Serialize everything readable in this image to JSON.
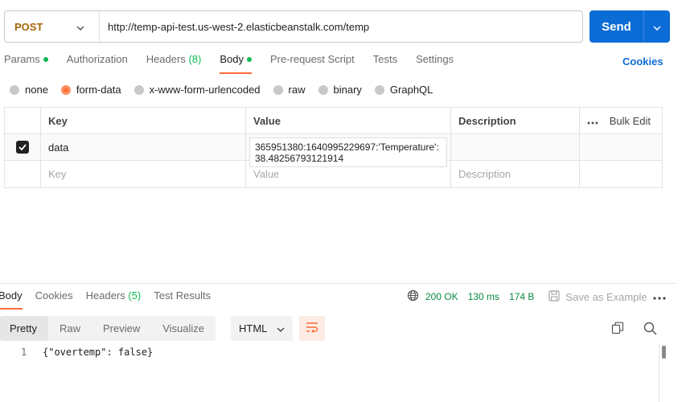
{
  "request": {
    "method": "POST",
    "url": "http://temp-api-test.us-west-2.elasticbeanstalk.com/temp",
    "send_label": "Send"
  },
  "request_tabs": [
    {
      "label": "Params",
      "dot": true
    },
    {
      "label": "Authorization"
    },
    {
      "label": "Headers",
      "count": "(8)"
    },
    {
      "label": "Body",
      "dot": true,
      "active": true
    },
    {
      "label": "Pre-request Script"
    },
    {
      "label": "Tests"
    },
    {
      "label": "Settings"
    }
  ],
  "cookies_label": "Cookies",
  "body_types": [
    {
      "label": "none"
    },
    {
      "label": "form-data",
      "selected": true
    },
    {
      "label": "x-www-form-urlencoded"
    },
    {
      "label": "raw"
    },
    {
      "label": "binary"
    },
    {
      "label": "GraphQL"
    }
  ],
  "params_table": {
    "headers": {
      "key": "Key",
      "value": "Value",
      "description": "Description",
      "bulk_edit": "Bulk Edit"
    },
    "row": {
      "key": "data",
      "value": "365951380:1640995229697:'Temperature':38.48256793121914",
      "checked": true
    },
    "placeholders": {
      "key": "Key",
      "value": "Value",
      "description": "Description"
    }
  },
  "response": {
    "tabs": [
      {
        "label": "Body",
        "active": true
      },
      {
        "label": "Cookies"
      },
      {
        "label": "Headers",
        "count": "(5)"
      },
      {
        "label": "Test Results"
      }
    ],
    "status": "200 OK",
    "time": "130 ms",
    "size": "174 B",
    "save_example_label": "Save as Example",
    "formats": [
      "Pretty",
      "Raw",
      "Preview",
      "Visualize"
    ],
    "language": "HTML",
    "code_line_number": "1",
    "code_line": "{\"overtemp\": false}"
  },
  "colors": {
    "accent_orange": "#ff6c37",
    "send_blue": "#0c6cd6",
    "success_green": "#0a8a41",
    "method_post": "#a3660b"
  }
}
